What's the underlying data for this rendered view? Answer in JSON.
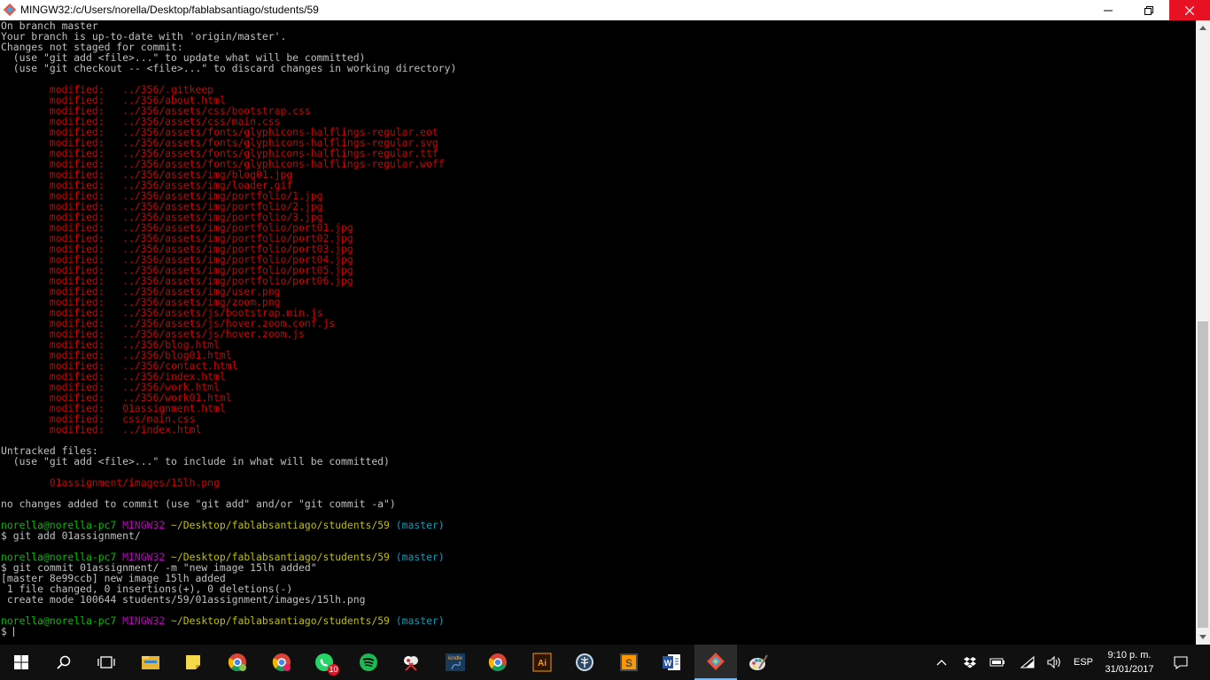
{
  "window": {
    "title": "MINGW32:/c/Users/norella/Desktop/fablabsantiago/students/59",
    "minimize_icon": "minimize-icon",
    "maximize_icon": "restore-icon",
    "close_icon": "close-icon"
  },
  "terminal": {
    "lines": [
      {
        "row": 0,
        "segments": [
          {
            "text": "On branch master",
            "color": "default"
          }
        ]
      },
      {
        "row": 1,
        "segments": [
          {
            "text": "Your branch is up-to-date with 'origin/master'.",
            "color": "default"
          }
        ]
      },
      {
        "row": 2,
        "segments": [
          {
            "text": "Changes not staged for commit:",
            "color": "default"
          }
        ]
      },
      {
        "row": 3,
        "segments": [
          {
            "text": "  (use \"git add <file>...\" to update what will be committed)",
            "color": "default"
          }
        ]
      },
      {
        "row": 4,
        "segments": [
          {
            "text": "  (use \"git checkout -- <file>...\" to discard changes in working directory)",
            "color": "default"
          }
        ]
      },
      {
        "row": 6,
        "segments": [
          {
            "text": "        modified:   ../356/.gitkeep",
            "color": "red"
          }
        ]
      },
      {
        "row": 7,
        "segments": [
          {
            "text": "        modified:   ../356/about.html",
            "color": "red"
          }
        ]
      },
      {
        "row": 8,
        "segments": [
          {
            "text": "        modified:   ../356/assets/css/bootstrap.css",
            "color": "red"
          }
        ]
      },
      {
        "row": 9,
        "segments": [
          {
            "text": "        modified:   ../356/assets/css/main.css",
            "color": "red"
          }
        ]
      },
      {
        "row": 10,
        "segments": [
          {
            "text": "        modified:   ../356/assets/fonts/glyphicons-halflings-regular.eot",
            "color": "red"
          }
        ]
      },
      {
        "row": 11,
        "segments": [
          {
            "text": "        modified:   ../356/assets/fonts/glyphicons-halflings-regular.svg",
            "color": "red"
          }
        ]
      },
      {
        "row": 12,
        "segments": [
          {
            "text": "        modified:   ../356/assets/fonts/glyphicons-halflings-regular.ttf",
            "color": "red"
          }
        ]
      },
      {
        "row": 13,
        "segments": [
          {
            "text": "        modified:   ../356/assets/fonts/glyphicons-halflings-regular.woff",
            "color": "red"
          }
        ]
      },
      {
        "row": 14,
        "segments": [
          {
            "text": "        modified:   ../356/assets/img/blog01.jpg",
            "color": "red"
          }
        ]
      },
      {
        "row": 15,
        "segments": [
          {
            "text": "        modified:   ../356/assets/img/loader.gif",
            "color": "red"
          }
        ]
      },
      {
        "row": 16,
        "segments": [
          {
            "text": "        modified:   ../356/assets/img/portfolio/1.jpg",
            "color": "red"
          }
        ]
      },
      {
        "row": 17,
        "segments": [
          {
            "text": "        modified:   ../356/assets/img/portfolio/2.jpg",
            "color": "red"
          }
        ]
      },
      {
        "row": 18,
        "segments": [
          {
            "text": "        modified:   ../356/assets/img/portfolio/3.jpg",
            "color": "red"
          }
        ]
      },
      {
        "row": 19,
        "segments": [
          {
            "text": "        modified:   ../356/assets/img/portfolio/port01.jpg",
            "color": "red"
          }
        ]
      },
      {
        "row": 20,
        "segments": [
          {
            "text": "        modified:   ../356/assets/img/portfolio/port02.jpg",
            "color": "red"
          }
        ]
      },
      {
        "row": 21,
        "segments": [
          {
            "text": "        modified:   ../356/assets/img/portfolio/port03.jpg",
            "color": "red"
          }
        ]
      },
      {
        "row": 22,
        "segments": [
          {
            "text": "        modified:   ../356/assets/img/portfolio/port04.jpg",
            "color": "red"
          }
        ]
      },
      {
        "row": 23,
        "segments": [
          {
            "text": "        modified:   ../356/assets/img/portfolio/port05.jpg",
            "color": "red"
          }
        ]
      },
      {
        "row": 24,
        "segments": [
          {
            "text": "        modified:   ../356/assets/img/portfolio/port06.jpg",
            "color": "red"
          }
        ]
      },
      {
        "row": 25,
        "segments": [
          {
            "text": "        modified:   ../356/assets/img/user.png",
            "color": "red"
          }
        ]
      },
      {
        "row": 26,
        "segments": [
          {
            "text": "        modified:   ../356/assets/img/zoom.png",
            "color": "red"
          }
        ]
      },
      {
        "row": 27,
        "segments": [
          {
            "text": "        modified:   ../356/assets/js/bootstrap.min.js",
            "color": "red"
          }
        ]
      },
      {
        "row": 28,
        "segments": [
          {
            "text": "        modified:   ../356/assets/js/hover.zoom.conf.js",
            "color": "red"
          }
        ]
      },
      {
        "row": 29,
        "segments": [
          {
            "text": "        modified:   ../356/assets/js/hover.zoom.js",
            "color": "red"
          }
        ]
      },
      {
        "row": 30,
        "segments": [
          {
            "text": "        modified:   ../356/blog.html",
            "color": "red"
          }
        ]
      },
      {
        "row": 31,
        "segments": [
          {
            "text": "        modified:   ../356/blog01.html",
            "color": "red"
          }
        ]
      },
      {
        "row": 32,
        "segments": [
          {
            "text": "        modified:   ../356/contact.html",
            "color": "red"
          }
        ]
      },
      {
        "row": 33,
        "segments": [
          {
            "text": "        modified:   ../356/index.html",
            "color": "red"
          }
        ]
      },
      {
        "row": 34,
        "segments": [
          {
            "text": "        modified:   ../356/work.html",
            "color": "red"
          }
        ]
      },
      {
        "row": 35,
        "segments": [
          {
            "text": "        modified:   ../356/work01.html",
            "color": "red"
          }
        ]
      },
      {
        "row": 36,
        "segments": [
          {
            "text": "        modified:   01assignment.html",
            "color": "red"
          }
        ]
      },
      {
        "row": 37,
        "segments": [
          {
            "text": "        modified:   css/main.css",
            "color": "red"
          }
        ]
      },
      {
        "row": 38,
        "segments": [
          {
            "text": "        modified:   ../index.html",
            "color": "red"
          }
        ]
      },
      {
        "row": 40,
        "segments": [
          {
            "text": "Untracked files:",
            "color": "default"
          }
        ]
      },
      {
        "row": 41,
        "segments": [
          {
            "text": "  (use \"git add <file>...\" to include in what will be committed)",
            "color": "default"
          }
        ]
      },
      {
        "row": 43,
        "segments": [
          {
            "text": "        01assignment/images/15lh.png",
            "color": "red"
          }
        ]
      },
      {
        "row": 45,
        "segments": [
          {
            "text": "no changes added to commit (use \"git add\" and/or \"git commit -a\")",
            "color": "default"
          }
        ]
      },
      {
        "row": 47,
        "segments": [
          {
            "text": "norella@norella-pc7 ",
            "color": "green"
          },
          {
            "text": "MINGW32 ",
            "color": "magenta"
          },
          {
            "text": "~/Desktop/fablabsantiago/students/59",
            "color": "yellow"
          },
          {
            "text": " (master)",
            "color": "cyan"
          }
        ]
      },
      {
        "row": 48,
        "segments": [
          {
            "text": "$ git add 01assignment/",
            "color": "default"
          }
        ]
      },
      {
        "row": 50,
        "segments": [
          {
            "text": "norella@norella-pc7 ",
            "color": "green"
          },
          {
            "text": "MINGW32 ",
            "color": "magenta"
          },
          {
            "text": "~/Desktop/fablabsantiago/students/59",
            "color": "yellow"
          },
          {
            "text": " (master)",
            "color": "cyan"
          }
        ]
      },
      {
        "row": 51,
        "segments": [
          {
            "text": "$ git commit 01assignment/ -m \"new image 15lh added\"",
            "color": "default"
          }
        ]
      },
      {
        "row": 52,
        "segments": [
          {
            "text": "[master 8e99ccb] new image 15lh added",
            "color": "default"
          }
        ]
      },
      {
        "row": 53,
        "segments": [
          {
            "text": " 1 file changed, 0 insertions(+), 0 deletions(-)",
            "color": "default"
          }
        ]
      },
      {
        "row": 54,
        "segments": [
          {
            "text": " create mode 100644 students/59/01assignment/images/15lh.png",
            "color": "default"
          }
        ]
      },
      {
        "row": 56,
        "segments": [
          {
            "text": "norella@norella-pc7 ",
            "color": "green"
          },
          {
            "text": "MINGW32 ",
            "color": "magenta"
          },
          {
            "text": "~/Desktop/fablabsantiago/students/59",
            "color": "yellow"
          },
          {
            "text": " (master)",
            "color": "cyan"
          }
        ]
      }
    ],
    "prompt_row": 57,
    "prompt_text": "$ "
  },
  "colors": {
    "default": "#c0c0c0",
    "red": "#d00000",
    "green": "#00c000",
    "magenta": "#c000c0",
    "yellow": "#c0c000",
    "cyan": "#00a0c0",
    "background": "#000000",
    "taskbar": "#101010",
    "accent": "#76b9ed"
  },
  "taskbar": {
    "items": [
      {
        "name": "windows-start-icon",
        "active": false
      },
      {
        "name": "search-icon",
        "active": false
      },
      {
        "name": "task-view-icon",
        "active": false
      },
      {
        "name": "file-explorer-icon",
        "active": false
      },
      {
        "name": "sticky-notes-icon",
        "active": false
      },
      {
        "name": "chrome-profile-icon",
        "active": false
      },
      {
        "name": "chrome-profile-icon",
        "active": false
      },
      {
        "name": "whatsapp-icon",
        "active": false,
        "badge": "10"
      },
      {
        "name": "spotify-icon",
        "active": false
      },
      {
        "name": "snipping-tool-icon",
        "active": false
      },
      {
        "name": "kindle-icon",
        "active": false
      },
      {
        "name": "chrome-icon",
        "active": false
      },
      {
        "name": "illustrator-icon",
        "active": false
      },
      {
        "name": "tree-app-icon",
        "active": false
      },
      {
        "name": "sublime-text-icon",
        "active": false
      },
      {
        "name": "word-icon",
        "active": false
      },
      {
        "name": "git-bash-icon",
        "active": true
      },
      {
        "name": "paint-icon",
        "active": false
      }
    ],
    "tray": {
      "chevron_icon": "chevron-up-icon",
      "dropbox_icon": "dropbox-icon",
      "battery_icon": "battery-icon",
      "wifi_icon": "wifi-icon",
      "volume_icon": "volume-icon",
      "language": "ESP",
      "time": "9:10 p. m.",
      "date": "31/01/2017",
      "notification_icon": "notification-icon"
    },
    "labels": {
      "illustrator": "Ai",
      "kindle": "kindle",
      "sublime": "S",
      "word": "W"
    }
  }
}
